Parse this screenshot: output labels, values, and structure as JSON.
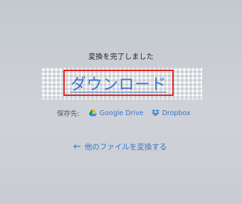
{
  "status": {
    "message": "変換を完了しました"
  },
  "download": {
    "label": "ダウンロード"
  },
  "save_to": {
    "label": "保存先:",
    "services": [
      {
        "name": "Google Drive",
        "icon": "google-drive-icon"
      },
      {
        "name": "Dropbox",
        "icon": "dropbox-icon"
      }
    ]
  },
  "back": {
    "arrow": "←",
    "label": "他のファイルを変換する"
  },
  "colors": {
    "link": "#3b72c9",
    "highlight_border": "#e32424",
    "background": "#c9cdd3"
  }
}
